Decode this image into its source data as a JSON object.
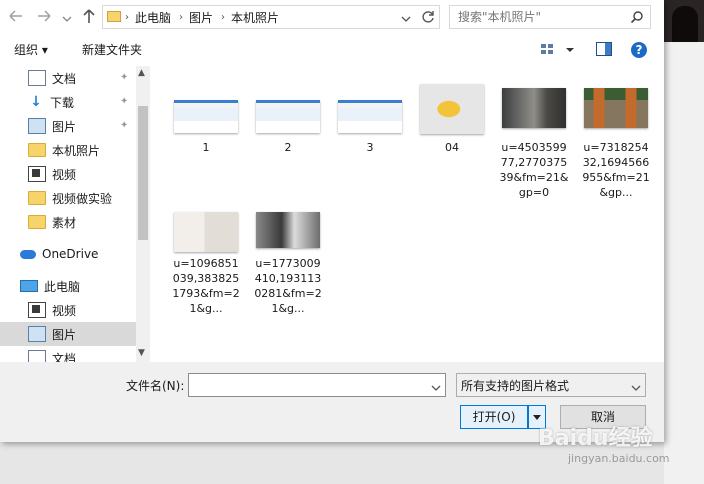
{
  "navbar": {
    "back_icon": "arrow-left",
    "forward_icon": "arrow-right",
    "recent_icon": "chevron-down",
    "up_icon": "arrow-up",
    "breadcrumb": [
      "此电脑",
      "图片",
      "本机照片"
    ],
    "refresh_icon": "refresh",
    "search_placeholder": "搜索\"本机照片\""
  },
  "toolbar": {
    "organize_label": "组织 ▾",
    "new_folder_label": "新建文件夹"
  },
  "sidebar": {
    "items": [
      {
        "label": "文档",
        "icon": "document-icon",
        "pinned": true
      },
      {
        "label": "下载",
        "icon": "download-icon",
        "pinned": true
      },
      {
        "label": "图片",
        "icon": "picture-icon",
        "pinned": true
      },
      {
        "label": "本机照片",
        "icon": "folder-icon",
        "pinned": false
      },
      {
        "label": "视频",
        "icon": "video-icon",
        "pinned": false
      },
      {
        "label": "视频做实验",
        "icon": "folder-icon",
        "pinned": false
      },
      {
        "label": "素材",
        "icon": "folder-icon",
        "pinned": false
      },
      {
        "label": "OneDrive",
        "icon": "cloud-icon",
        "pinned": false
      },
      {
        "label": "此电脑",
        "icon": "computer-icon",
        "pinned": false
      },
      {
        "label": "视频",
        "icon": "video-icon",
        "pinned": false
      },
      {
        "label": "图片",
        "icon": "picture-icon",
        "pinned": false,
        "selected": true
      },
      {
        "label": "文档",
        "icon": "document-icon",
        "pinned": false
      }
    ]
  },
  "files": [
    {
      "name": "1",
      "thumb": "webpage-screenshot"
    },
    {
      "name": "2",
      "thumb": "webpage-screenshot"
    },
    {
      "name": "3",
      "thumb": "webpage-screenshot"
    },
    {
      "name": "04",
      "thumb": "yellow-graphic"
    },
    {
      "name": "u=450359977,277037539&fm=21&gp=0",
      "thumb": "street-photo"
    },
    {
      "name": "u=731825432,1694566955&fm=21&gp...",
      "thumb": "doors-photo"
    },
    {
      "name": "u=1096851039,3838251793&fm=21&g...",
      "thumb": "wedding-photo"
    },
    {
      "name": "u=1773009410,1931130281&fm=21&g...",
      "thumb": "wedding-photo-bw"
    }
  ],
  "bottom": {
    "filename_label": "文件名(N):",
    "filename_value": "",
    "filetype_value": "所有支持的图片格式",
    "open_label": "打开(O)",
    "cancel_label": "取消"
  },
  "watermark": {
    "text": "Baidu经验",
    "url": "jingyan.baidu.com"
  },
  "colors": {
    "accent": "#0078d7",
    "selection": "#d9d9d9",
    "folder": "#f6d36b"
  }
}
